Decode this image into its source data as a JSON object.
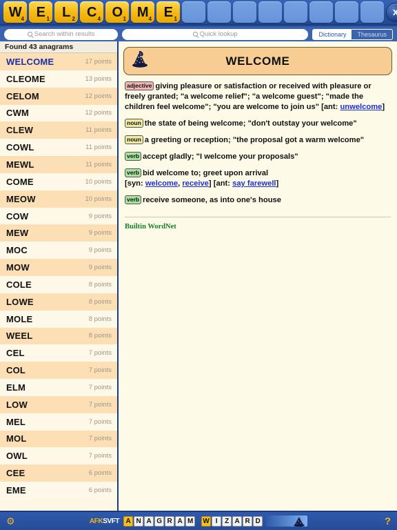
{
  "rack": {
    "tiles": [
      {
        "letter": "W",
        "points": "4"
      },
      {
        "letter": "E",
        "points": "1"
      },
      {
        "letter": "L",
        "points": "2"
      },
      {
        "letter": "C",
        "points": "4"
      },
      {
        "letter": "O",
        "points": "1"
      },
      {
        "letter": "M",
        "points": "4"
      },
      {
        "letter": "E",
        "points": "1"
      }
    ],
    "empty_slots": 8,
    "close_label": "x"
  },
  "search": {
    "within_results_placeholder": "Search within results",
    "within_results_value": "",
    "quick_lookup_placeholder": "Quick lookup",
    "quick_lookup_value": "",
    "modes": [
      {
        "label": "Dictionary",
        "selected": true
      },
      {
        "label": "Thesaurus",
        "selected": false
      }
    ]
  },
  "results": {
    "header": "Found 43 anagrams",
    "selected_word": "WELCOME",
    "items": [
      {
        "word": "WELCOME",
        "points": "17 points"
      },
      {
        "word": "CLEOME",
        "points": "13 points"
      },
      {
        "word": "CELOM",
        "points": "12 points"
      },
      {
        "word": "CWM",
        "points": "12 points"
      },
      {
        "word": "CLEW",
        "points": "11 points"
      },
      {
        "word": "COWL",
        "points": "11 points"
      },
      {
        "word": "MEWL",
        "points": "11 points"
      },
      {
        "word": "COME",
        "points": "10 points"
      },
      {
        "word": "MEOW",
        "points": "10 points"
      },
      {
        "word": "COW",
        "points": "9 points"
      },
      {
        "word": "MEW",
        "points": "9 points"
      },
      {
        "word": "MOC",
        "points": "9 points"
      },
      {
        "word": "MOW",
        "points": "9 points"
      },
      {
        "word": "COLE",
        "points": "8 points"
      },
      {
        "word": "LOWE",
        "points": "8 points"
      },
      {
        "word": "MOLE",
        "points": "8 points"
      },
      {
        "word": "WEEL",
        "points": "8 points"
      },
      {
        "word": "CEL",
        "points": "7 points"
      },
      {
        "word": "COL",
        "points": "7 points"
      },
      {
        "word": "ELM",
        "points": "7 points"
      },
      {
        "word": "LOW",
        "points": "7 points"
      },
      {
        "word": "MEL",
        "points": "7 points"
      },
      {
        "word": "MOL",
        "points": "7 points"
      },
      {
        "word": "OWL",
        "points": "7 points"
      },
      {
        "word": "CEE",
        "points": "6 points"
      },
      {
        "word": "EME",
        "points": "6 points"
      }
    ]
  },
  "detail": {
    "headword": "WELCOME",
    "icon": "wizard-hat-icon",
    "senses": [
      {
        "pos": "adjective",
        "parts": [
          {
            "t": "text",
            "v": "giving pleasure or satisfaction or received with pleasure or freely granted; \"a welcome relief\"; \"a welcome guest\"; \"made the children feel welcome\"; \"you are welcome to join us\" [ant: "
          },
          {
            "t": "link",
            "v": "unwelcome"
          },
          {
            "t": "text",
            "v": "]"
          }
        ]
      },
      {
        "pos": "noun",
        "parts": [
          {
            "t": "text",
            "v": "the state of being welcome; \"don't outstay your welcome\""
          }
        ]
      },
      {
        "pos": "noun",
        "parts": [
          {
            "t": "text",
            "v": "a greeting or reception; \"the proposal got a warm welcome\""
          }
        ]
      },
      {
        "pos": "verb",
        "parts": [
          {
            "t": "text",
            "v": "accept gladly; \"I welcome your proposals\""
          }
        ]
      },
      {
        "pos": "verb",
        "parts": [
          {
            "t": "text",
            "v": "bid welcome to; greet upon arrival"
          },
          {
            "t": "break",
            "v": ""
          },
          {
            "t": "text",
            "v": "[syn: "
          },
          {
            "t": "link",
            "v": "welcome"
          },
          {
            "t": "text",
            "v": ", "
          },
          {
            "t": "link",
            "v": "receive"
          },
          {
            "t": "text",
            "v": "] [ant: "
          },
          {
            "t": "link",
            "v": "say farewell"
          },
          {
            "t": "text",
            "v": "]"
          }
        ]
      },
      {
        "pos": "verb",
        "parts": [
          {
            "t": "text",
            "v": "receive someone, as into one's house"
          }
        ]
      }
    ],
    "source": "Builtin WordNet"
  },
  "footer": {
    "gear_icon": "gear-icon",
    "brand_prefix_gold": "AFK",
    "brand_prefix_white": "SVFT",
    "brand_word_one": "ANAGRAM",
    "brand_word_two": "WIZARD",
    "help_label": "?"
  },
  "colors": {
    "chrome_blue": "#2a55a5",
    "tile_gold": "#f5b812",
    "paper": "#fdfae8",
    "row_even": "#fcdfb5",
    "row_odd": "#fdf8e8",
    "link": "#1c2fd8",
    "source_green": "#12822a"
  }
}
